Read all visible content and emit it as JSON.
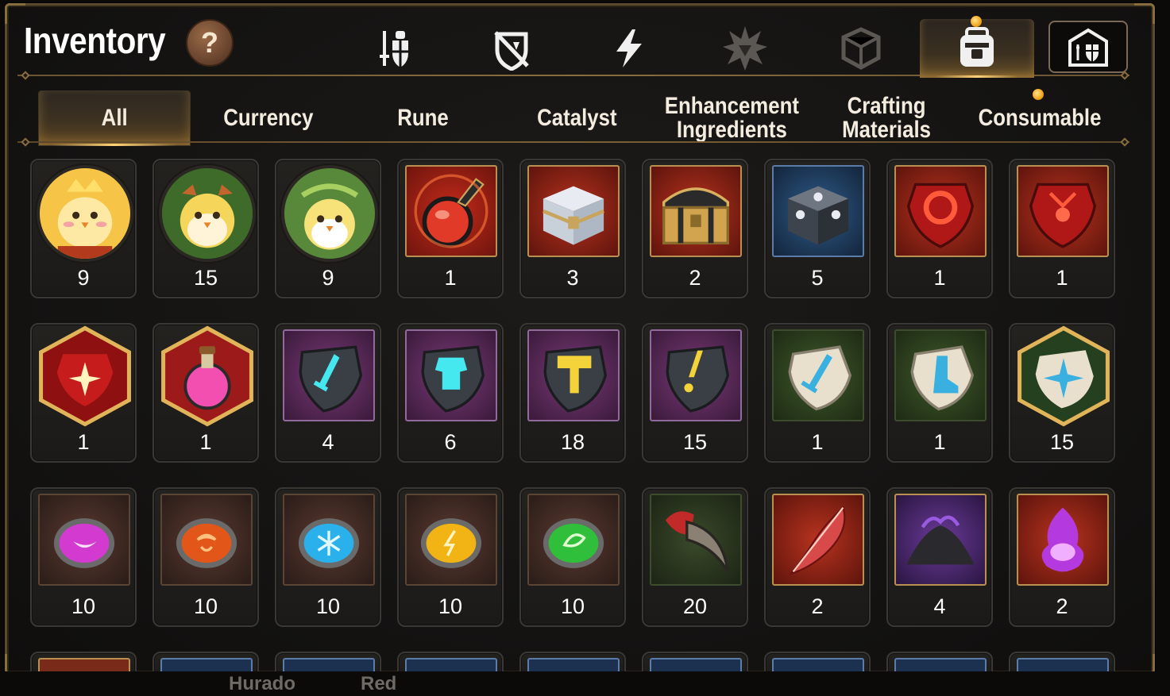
{
  "header": {
    "title": "Inventory",
    "help_label": "?"
  },
  "icon_tabs": [
    {
      "name": "sword-shield-icon",
      "active": false
    },
    {
      "name": "broken-shield-icon",
      "active": false
    },
    {
      "name": "lightning-icon",
      "active": false
    },
    {
      "name": "burst-emblem-icon",
      "active": false
    },
    {
      "name": "cube-icon",
      "active": false
    },
    {
      "name": "backpack-icon",
      "active": true,
      "notification": true
    },
    {
      "name": "castle-armory-icon",
      "active": false
    }
  ],
  "categories": [
    {
      "label": "All",
      "active": true
    },
    {
      "label": "Currency"
    },
    {
      "label": "Rune"
    },
    {
      "label": "Catalyst"
    },
    {
      "label": "Enhancement\nIngredients"
    },
    {
      "label": "Crafting\nMaterials"
    },
    {
      "label": "Consumable",
      "notification": true
    }
  ],
  "items": [
    [
      {
        "icon": "golden-chick-portrait-icon",
        "count": "9"
      },
      {
        "icon": "green-chick-portrait-icon",
        "count": "15"
      },
      {
        "icon": "laurel-chick-portrait-icon",
        "count": "9"
      },
      {
        "icon": "red-potion-flask-icon",
        "count": "1"
      },
      {
        "icon": "silver-chest-icon",
        "count": "3"
      },
      {
        "icon": "gold-chest-icon",
        "count": "2"
      },
      {
        "icon": "dark-silver-chest-icon",
        "count": "5"
      },
      {
        "icon": "red-gem-ring-icon",
        "count": "1"
      },
      {
        "icon": "red-gem-necklace-icon",
        "count": "1"
      }
    ],
    [
      {
        "icon": "red-star-gem-icon",
        "count": "1"
      },
      {
        "icon": "pink-potion-icon",
        "count": "1"
      },
      {
        "icon": "sword-rune-stone-icon",
        "count": "4"
      },
      {
        "icon": "armor-rune-stone-icon",
        "count": "6"
      },
      {
        "icon": "hammer-rune-stone-icon",
        "count": "18"
      },
      {
        "icon": "spark-rune-stone-icon",
        "count": "15"
      },
      {
        "icon": "sword-runic-tablet-icon",
        "count": "1"
      },
      {
        "icon": "boot-runic-tablet-icon",
        "count": "1"
      },
      {
        "icon": "star-runic-tablet-icon",
        "count": "15"
      }
    ],
    [
      {
        "icon": "purple-moon-orb-icon",
        "count": "10"
      },
      {
        "icon": "orange-fire-orb-icon",
        "count": "10"
      },
      {
        "icon": "blue-ice-orb-icon",
        "count": "10"
      },
      {
        "icon": "yellow-bolt-orb-icon",
        "count": "10"
      },
      {
        "icon": "green-leaf-orb-icon",
        "count": "10"
      },
      {
        "icon": "beast-claw-icon",
        "count": "20"
      },
      {
        "icon": "red-feather-icon",
        "count": "2"
      },
      {
        "icon": "dark-dust-pile-icon",
        "count": "4"
      },
      {
        "icon": "purple-flame-icon",
        "count": "2"
      }
    ]
  ],
  "obscured_text": [
    "Hurado",
    "Red"
  ],
  "colors": {
    "accent_gold": "#ffd27a",
    "notification": "#f0a51c",
    "frame": "#5c4a2c"
  }
}
